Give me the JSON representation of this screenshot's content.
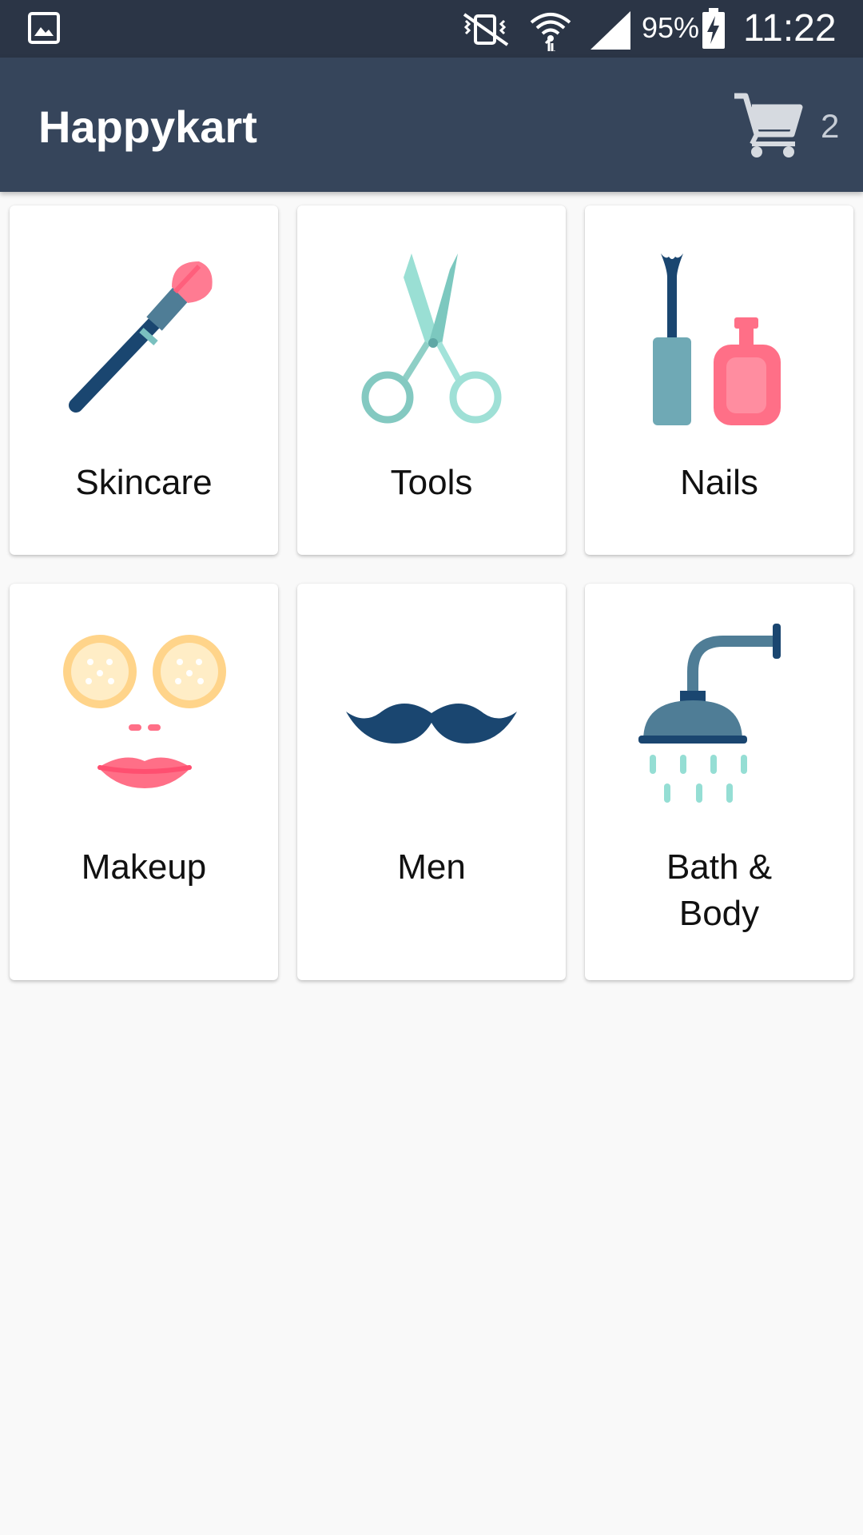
{
  "status_bar": {
    "battery_percent": "95%",
    "time": "11:22",
    "icons": [
      "gallery-icon",
      "vibrate-off-icon",
      "wifi-icon",
      "cell-signal-icon",
      "battery-charging-icon"
    ]
  },
  "app_bar": {
    "title": "Happykart",
    "cart_count": "2",
    "cart_icon": "shopping-cart-icon"
  },
  "colors": {
    "status_bar_bg": "#2b3546",
    "app_bar_bg": "#36455b",
    "page_bg": "#f9f9f9",
    "card_bg": "#ffffff",
    "navy": "#1a4670",
    "teal": "#6fa9b5",
    "mint": "#95ded4",
    "pink": "#ff6f87",
    "peach": "#ffd48a"
  },
  "categories": [
    {
      "label": "Skincare",
      "icon": "makeup-brush-icon"
    },
    {
      "label": "Tools",
      "icon": "scissors-icon"
    },
    {
      "label": "Nails",
      "icon": "nail-polish-icon"
    },
    {
      "label": "Makeup",
      "icon": "face-mask-icon"
    },
    {
      "label": "Men",
      "icon": "mustache-icon"
    },
    {
      "label": "Bath & Body",
      "icon": "shower-icon"
    }
  ]
}
